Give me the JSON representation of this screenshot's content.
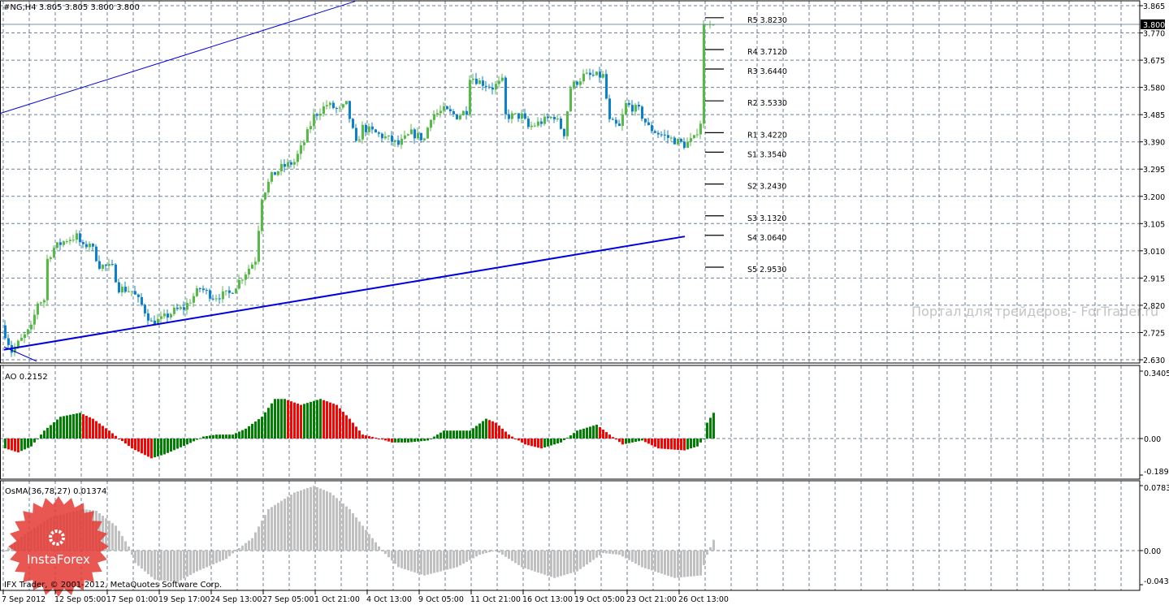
{
  "header": {
    "symbol_info": "#NG,H4  3.805 3.805 3.800 3.800"
  },
  "current_price": "3.800",
  "colors": {
    "bull": "#55bb44",
    "bear": "#0a80d0",
    "ao_up": "#008000",
    "ao_down": "#ff0000",
    "osma": "#c0c0c0",
    "grid": "#6e8199",
    "trendline": "#0000dd",
    "current_line": "#7890a8"
  },
  "watermark": "Портал для трейдеров - ForTrader.ru",
  "logo_text": "InstaForex",
  "copyright": "IFX Trader, © 2001-2012, MetaQuotes Software Corp.",
  "chart_data": [
    {
      "type": "candlestick",
      "title": "#NG,H4",
      "ylim": [
        2.63,
        3.865
      ],
      "y_ticks": [
        "3.865",
        "3.770",
        "3.675",
        "3.580",
        "3.485",
        "3.390",
        "3.295",
        "3.200",
        "3.105",
        "3.010",
        "2.915",
        "2.820",
        "2.725",
        "2.630"
      ],
      "close_keypoints": [
        [
          0,
          2.72
        ],
        [
          2,
          2.66
        ],
        [
          5,
          2.7
        ],
        [
          8,
          2.74
        ],
        [
          10,
          2.83
        ],
        [
          12,
          2.84
        ],
        [
          13,
          2.98
        ],
        [
          15,
          3.02
        ],
        [
          19,
          3.05
        ],
        [
          22,
          3.06
        ],
        [
          24,
          3.02
        ],
        [
          26,
          3.04
        ],
        [
          29,
          2.96
        ],
        [
          33,
          2.95
        ],
        [
          35,
          2.88
        ],
        [
          39,
          2.87
        ],
        [
          42,
          2.82
        ],
        [
          45,
          2.76
        ],
        [
          48,
          2.77
        ],
        [
          52,
          2.8
        ],
        [
          55,
          2.81
        ],
        [
          60,
          2.88
        ],
        [
          64,
          2.85
        ],
        [
          69,
          2.86
        ],
        [
          73,
          2.92
        ],
        [
          77,
          2.98
        ],
        [
          79,
          3.2
        ],
        [
          82,
          3.27
        ],
        [
          85,
          3.3
        ],
        [
          89,
          3.32
        ],
        [
          92,
          3.39
        ],
        [
          95,
          3.48
        ],
        [
          99,
          3.52
        ],
        [
          103,
          3.5
        ],
        [
          105,
          3.52
        ],
        [
          108,
          3.38
        ],
        [
          110,
          3.44
        ],
        [
          114,
          3.42
        ],
        [
          118,
          3.4
        ],
        [
          121,
          3.38
        ],
        [
          125,
          3.42
        ],
        [
          129,
          3.4
        ],
        [
          131,
          3.48
        ],
        [
          135,
          3.5
        ],
        [
          139,
          3.48
        ],
        [
          142,
          3.5
        ],
        [
          143,
          3.62
        ],
        [
          146,
          3.6
        ],
        [
          150,
          3.58
        ],
        [
          153,
          3.6
        ],
        [
          154,
          3.48
        ],
        [
          159,
          3.48
        ],
        [
          161,
          3.44
        ],
        [
          165,
          3.46
        ],
        [
          169,
          3.48
        ],
        [
          172,
          3.42
        ],
        [
          174,
          3.58
        ],
        [
          178,
          3.62
        ],
        [
          182,
          3.62
        ],
        [
          184,
          3.62
        ],
        [
          186,
          3.46
        ],
        [
          189,
          3.44
        ],
        [
          191,
          3.52
        ],
        [
          195,
          3.5
        ],
        [
          198,
          3.44
        ],
        [
          201,
          3.42
        ],
        [
          205,
          3.4
        ],
        [
          209,
          3.38
        ],
        [
          212,
          3.4
        ],
        [
          214,
          3.46
        ],
        [
          215,
          3.8
        ],
        [
          218,
          3.8
        ]
      ],
      "pivots": [
        {
          "label": "R5",
          "value": "3.8230"
        },
        {
          "label": "R4",
          "value": "3.7120"
        },
        {
          "label": "R3",
          "value": "3.6440"
        },
        {
          "label": "R2",
          "value": "3.5330"
        },
        {
          "label": "R1",
          "value": "3.4220"
        },
        {
          "label": "S1",
          "value": "3.3540"
        },
        {
          "label": "S2",
          "value": "3.2430"
        },
        {
          "label": "S3",
          "value": "3.1320"
        },
        {
          "label": "S4",
          "value": "3.0640"
        },
        {
          "label": "S5",
          "value": "2.9530"
        }
      ],
      "trendlines": [
        {
          "from": [
            -1,
            3.49
          ],
          "to": [
            108,
            3.88
          ]
        },
        {
          "from": [
            0,
            2.665
          ],
          "to": [
            209.5,
            3.06
          ]
        },
        {
          "from": [
            0,
            2.675
          ],
          "to": [
            10,
            2.625
          ]
        }
      ]
    },
    {
      "type": "bar",
      "title": "AO 0.2152",
      "ylim": [
        -0.1898,
        0.3405
      ],
      "y_ticks": [
        "0.3405",
        "0.00",
        "-0.1898"
      ],
      "keypoints": [
        [
          0,
          -0.05
        ],
        [
          4,
          -0.07
        ],
        [
          8,
          -0.04
        ],
        [
          12,
          0.04
        ],
        [
          17,
          0.11
        ],
        [
          23,
          0.13
        ],
        [
          27,
          0.1
        ],
        [
          32,
          0.04
        ],
        [
          35,
          0.0
        ],
        [
          39,
          -0.05
        ],
        [
          45,
          -0.1
        ],
        [
          49,
          -0.08
        ],
        [
          56,
          -0.03
        ],
        [
          61,
          0.01
        ],
        [
          65,
          0.02
        ],
        [
          70,
          0.02
        ],
        [
          74,
          0.05
        ],
        [
          79,
          0.11
        ],
        [
          83,
          0.2
        ],
        [
          86,
          0.2
        ],
        [
          91,
          0.17
        ],
        [
          97,
          0.2
        ],
        [
          102,
          0.17
        ],
        [
          106,
          0.1
        ],
        [
          110,
          0.02
        ],
        [
          115,
          0.0
        ],
        [
          119,
          -0.02
        ],
        [
          124,
          -0.02
        ],
        [
          130,
          -0.01
        ],
        [
          135,
          0.04
        ],
        [
          143,
          0.04
        ],
        [
          148,
          0.1
        ],
        [
          151,
          0.08
        ],
        [
          155,
          0.02
        ],
        [
          160,
          -0.03
        ],
        [
          165,
          -0.05
        ],
        [
          171,
          -0.02
        ],
        [
          176,
          0.04
        ],
        [
          182,
          0.07
        ],
        [
          186,
          0.02
        ],
        [
          190,
          -0.03
        ],
        [
          196,
          -0.01
        ],
        [
          201,
          -0.05
        ],
        [
          209,
          -0.06
        ],
        [
          213,
          -0.04
        ],
        [
          215,
          0.0
        ],
        [
          216,
          0.08
        ],
        [
          218,
          0.13
        ]
      ]
    },
    {
      "type": "bar",
      "title": "OsMA(36,78,27) 0.01374",
      "ylim": [
        -0.04383,
        0.07833
      ],
      "y_ticks": [
        "0.07833",
        "0.00",
        "-0.04383"
      ],
      "keypoints": [
        [
          0,
          0.0
        ],
        [
          6,
          0.02
        ],
        [
          14,
          0.04
        ],
        [
          24,
          0.05
        ],
        [
          28,
          0.048
        ],
        [
          34,
          0.03
        ],
        [
          38,
          0.005
        ],
        [
          40,
          -0.015
        ],
        [
          46,
          -0.035
        ],
        [
          53,
          -0.038
        ],
        [
          59,
          -0.025
        ],
        [
          68,
          -0.01
        ],
        [
          71,
          0.0
        ],
        [
          76,
          0.015
        ],
        [
          81,
          0.05
        ],
        [
          89,
          0.07
        ],
        [
          95,
          0.078
        ],
        [
          100,
          0.07
        ],
        [
          106,
          0.05
        ],
        [
          113,
          0.015
        ],
        [
          116,
          0.0
        ],
        [
          121,
          -0.02
        ],
        [
          129,
          -0.03
        ],
        [
          139,
          -0.02
        ],
        [
          146,
          -0.005
        ],
        [
          151,
          0.0
        ],
        [
          159,
          -0.02
        ],
        [
          169,
          -0.033
        ],
        [
          176,
          -0.025
        ],
        [
          184,
          -0.003
        ],
        [
          189,
          -0.005
        ],
        [
          196,
          -0.02
        ],
        [
          206,
          -0.033
        ],
        [
          214,
          -0.03
        ],
        [
          216,
          -0.005
        ],
        [
          218,
          0.013
        ]
      ]
    }
  ],
  "time_axis": [
    "7 Sep 2012",
    "12 Sep 05:00",
    "17 Sep 01:00",
    "19 Sep 17:00",
    "24 Sep 13:00",
    "27 Sep 05:00",
    "1 Oct 21:00",
    "4 Oct 13:00",
    "9 Oct 05:00",
    "11 Oct 21:00",
    "16 Oct 13:00",
    "19 Oct 05:00",
    "23 Oct 21:00",
    "26 Oct 13:00"
  ]
}
